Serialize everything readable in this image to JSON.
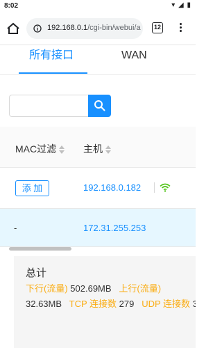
{
  "status_bar": {
    "time": "8:02",
    "icons": [
      "wifi-icon",
      "signal-icon",
      "battery-icon"
    ]
  },
  "browser": {
    "url_host": "192.168.0.1",
    "url_path": "/cgi-bin/webui/a",
    "tab_count": "12"
  },
  "tabs": [
    {
      "label": "所有接口",
      "active": true
    },
    {
      "label": "WAN",
      "active": false
    }
  ],
  "search": {
    "value": "",
    "placeholder": ""
  },
  "table": {
    "columns": [
      "MAC过滤",
      "主机"
    ],
    "rows": [
      {
        "action": "添 加",
        "host": "192.168.0.182",
        "icon": "wifi-icon"
      },
      {
        "action": "-",
        "host": "172.31.255.253",
        "icon": ""
      }
    ]
  },
  "summary": {
    "title": "总计",
    "download_label": "下行(流量)",
    "download_value": "502.69MB",
    "upload_label": "上行(流量)",
    "upload_value": "32.63MB",
    "tcp_label": "TCP 连接数",
    "tcp_value": "279",
    "udp_label": "UDP 连接数",
    "udp_value": "3"
  },
  "colors": {
    "accent": "#1890ff",
    "label_orange": "#faad14",
    "wifi_green": "#52c41a",
    "selected_row": "#e6f7ff"
  }
}
